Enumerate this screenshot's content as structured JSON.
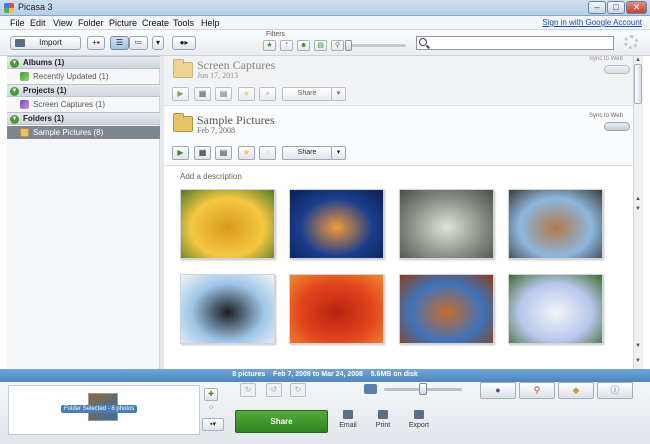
{
  "window": {
    "title": "Picasa 3"
  },
  "menu": {
    "items": [
      "File",
      "Edit",
      "View",
      "Folder",
      "Picture",
      "Create",
      "Tools",
      "Help"
    ],
    "signin": "Sign in with Google Account"
  },
  "toolbar": {
    "import_label": "Import",
    "filters_label": "Filters"
  },
  "sidebar": {
    "albums": {
      "label": "Albums (1)",
      "items": [
        {
          "label": "Recently Updated (1)"
        }
      ]
    },
    "projects": {
      "label": "Projects (1)",
      "items": [
        {
          "label": "Screen Captures (1)"
        }
      ]
    },
    "folders": {
      "label": "Folders (1)",
      "items": [
        {
          "label": "Sample Pictures (8)",
          "selected": true
        }
      ]
    }
  },
  "folders": [
    {
      "title": "Screen Captures",
      "date": "Jun 17, 2013",
      "sync_label": "Sync to Web",
      "share_label": "Share"
    },
    {
      "title": "Sample Pictures",
      "date": "Feb 7, 2008",
      "sync_label": "Sync to Web",
      "share_label": "Share",
      "description_placeholder": "Add a description"
    }
  ],
  "photos": [
    {
      "name": "Tulips",
      "colors": [
        "#f5c842",
        "#d89a18",
        "#4e7a27"
      ]
    },
    {
      "name": "Jellyfish",
      "colors": [
        "#1a3e8c",
        "#f39a3a",
        "#0b1f54"
      ]
    },
    {
      "name": "Koala",
      "colors": [
        "#8a8f86",
        "#e0e2dc",
        "#4a4f45"
      ]
    },
    {
      "name": "Lighthouse",
      "colors": [
        "#8db7de",
        "#b1794b",
        "#3b3b3b"
      ]
    },
    {
      "name": "Penguins",
      "colors": [
        "#9ec6e8",
        "#1c1c22",
        "#f1f3f5"
      ]
    },
    {
      "name": "Chrysanthemum",
      "colors": [
        "#e2441e",
        "#b6240f",
        "#f08a2e"
      ]
    },
    {
      "name": "Desert",
      "colors": [
        "#3f73b9",
        "#c66d2c",
        "#8c3f18"
      ]
    },
    {
      "name": "Hydrangeas",
      "colors": [
        "#b7c6ec",
        "#f3f4f8",
        "#3e6b2b"
      ]
    }
  ],
  "status": {
    "text": "8 pictures    Feb 7, 2008 to Mar 24, 2008    5.6MB on disk"
  },
  "tray": {
    "label": "Folder Selected - 8 photos"
  },
  "bottom": {
    "share_label": "Share",
    "actions": [
      {
        "label": "Email"
      },
      {
        "label": "Print"
      },
      {
        "label": "Export"
      }
    ]
  },
  "colors": {
    "accent": "#4d86bf",
    "share_green": "#3a8f2a",
    "selected_row": "#7f8791"
  }
}
